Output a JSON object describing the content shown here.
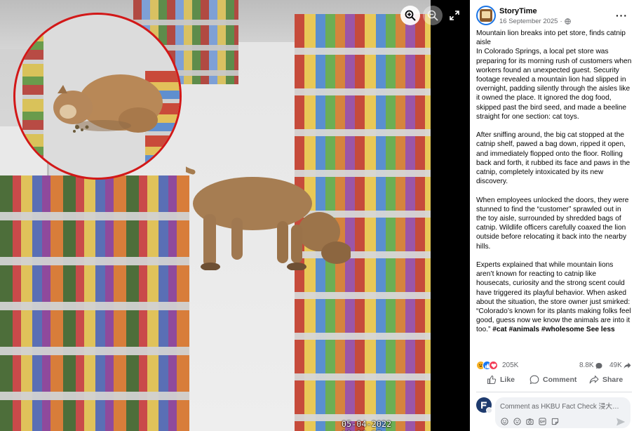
{
  "photo": {
    "timestamp": "05-04-2022 10:36:57",
    "controls": {
      "zoom_in_icon": "zoom-in-icon",
      "zoom_out_icon": "zoom-out-icon",
      "expand_icon": "expand-icon"
    }
  },
  "post": {
    "author": "StoryTime",
    "date": "16 September 2025",
    "visibility_icon": "globe-icon",
    "more_icon": "more-options-icon",
    "paragraphs": [
      "Mountain lion breaks into pet store, finds catnip aisle",
      "In Colorado Springs, a local pet store was preparing for its morning rush of customers when workers found an unexpected guest. Security footage revealed a mountain lion had slipped in overnight, padding silently through the aisles like it owned the place. It ignored the dog food, skipped past the bird seed, and made a beeline straight for one section: cat toys.",
      "After sniffing around, the big cat stopped at the catnip shelf, pawed a bag down, ripped it open, and immediately flopped onto the floor. Rolling back and forth, it rubbed its face and paws in the catnip, completely intoxicated by its new discovery.",
      "When employees unlocked the doors, they were stunned to find the “customer” sprawled out in the toy aisle, surrounded by shredded bags of catnip. Wildlife officers carefully coaxed the lion outside before relocating it back into the nearby hills.",
      "Experts explained that while mountain lions aren’t known for reacting to catnip like housecats, curiosity and the strong scent could have triggered its playful behavior. When asked about the situation, the store owner just smirked: “Colorado’s known for its plants making folks feel good, guess now we know the animals are into it too.”"
    ],
    "hashtags": [
      "#cat",
      "#animals",
      "#wholesome"
    ],
    "see_less": "See less"
  },
  "stats": {
    "reactions": "205K",
    "comments": "8.8K",
    "shares": "49K",
    "reaction_icons": [
      "haha-icon",
      "like-icon",
      "love-icon"
    ]
  },
  "actions": {
    "like": "Like",
    "comment": "Comment",
    "share": "Share"
  },
  "comment_box": {
    "placeholder": "Comment as HKBU Fact Check 浸大…",
    "tools": [
      "avatar-sticker-icon",
      "emoji-icon",
      "camera-icon",
      "gif-icon",
      "sticker-icon"
    ]
  },
  "colors": {
    "accent": "#1877f2",
    "inset_ring": "#d21818",
    "viewer_bg": "#000000",
    "muted_text": "#65676b"
  }
}
